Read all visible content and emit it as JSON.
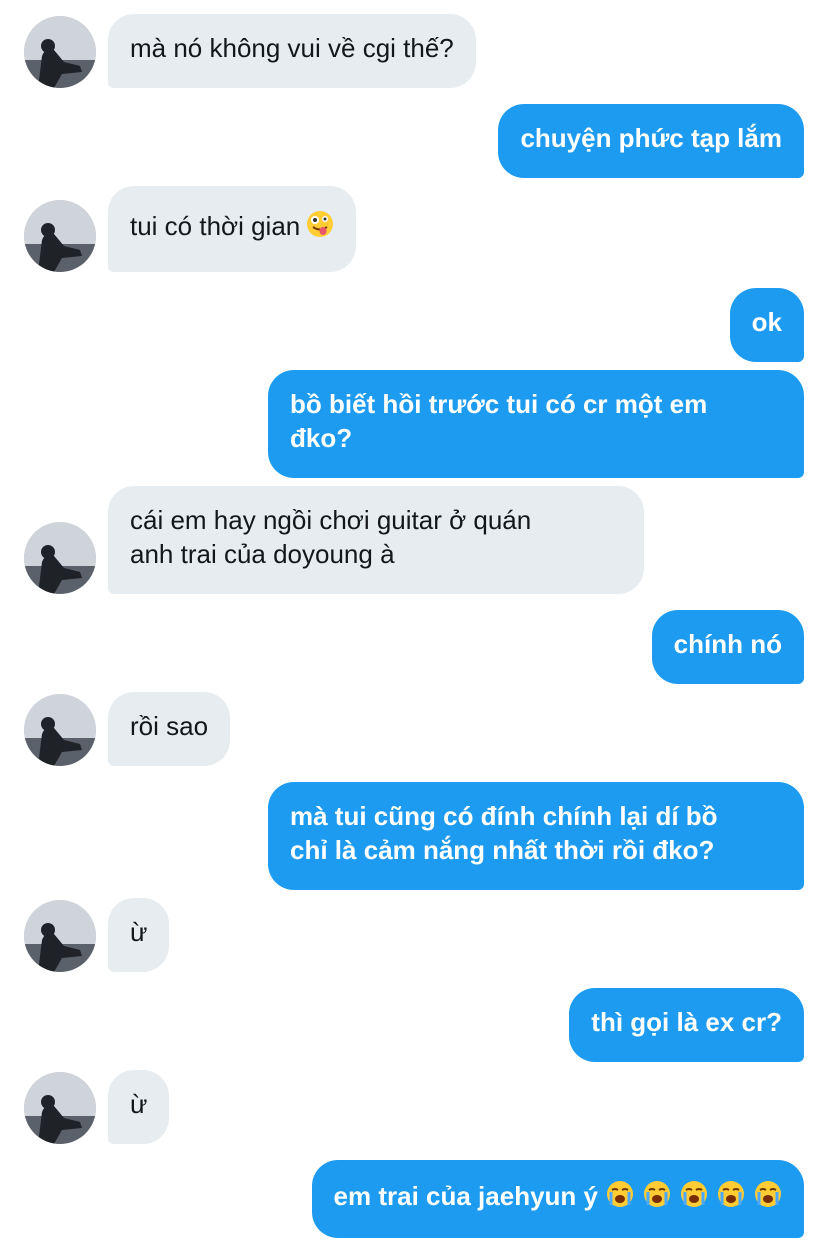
{
  "messages": [
    {
      "side": "in",
      "text": "mà nó không vui về cgi thế?"
    },
    {
      "side": "out",
      "text": "chuyện phức tạp lắm"
    },
    {
      "side": "in",
      "text": "tui có thời gian",
      "emoji": "zany-face-emoji"
    },
    {
      "side": "out",
      "text": "ok"
    },
    {
      "side": "out",
      "lines": [
        "bồ biết hồi trước tui có cr một em",
        "đko?"
      ]
    },
    {
      "side": "in",
      "lines": [
        "cái em hay ngồi chơi guitar ở quán",
        "anh trai của doyoung à"
      ]
    },
    {
      "side": "out",
      "text": "chính nó"
    },
    {
      "side": "in",
      "text": "rồi sao"
    },
    {
      "side": "out",
      "lines": [
        "mà tui cũng có đính chính lại dí bồ",
        "chỉ là cảm nắng nhất thời rồi đko?"
      ]
    },
    {
      "side": "in",
      "text": "ừ"
    },
    {
      "side": "out",
      "text": "thì gọi là ex cr?"
    },
    {
      "side": "in",
      "text": "ừ"
    },
    {
      "side": "out",
      "text": "em trai của jaehyun ý",
      "emoji": "loudly-crying-face-emoji",
      "emoji_count": 5
    }
  ],
  "colors": {
    "outgoing_bubble": "#1d9bf0",
    "incoming_bubble": "#e6ecf0",
    "incoming_text": "#14171a",
    "outgoing_text": "#ffffff"
  }
}
